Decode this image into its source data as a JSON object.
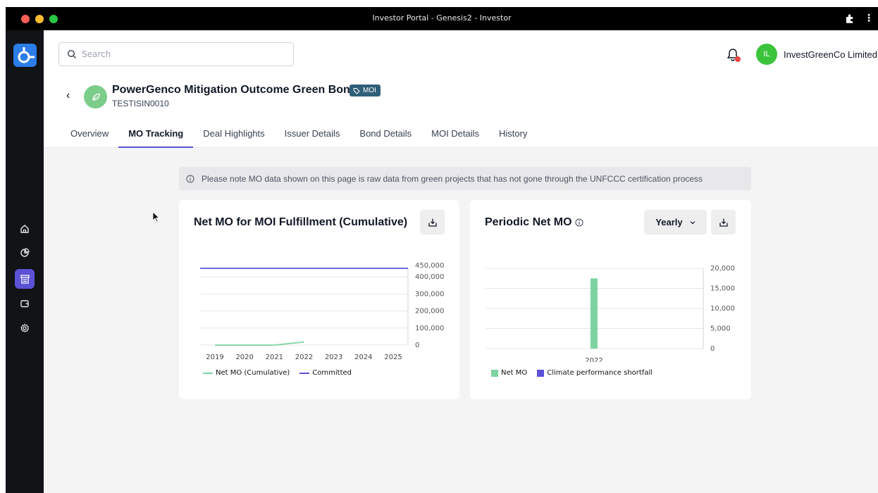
{
  "window": {
    "title": "Investor Portal - Genesis2 - Investor"
  },
  "search": {
    "placeholder": "Search"
  },
  "user": {
    "initials": "IL",
    "name": "InvestGreenCo Limited"
  },
  "bond": {
    "name": "PowerGenco Mitigation Outcome Green Bond",
    "tag": "MOI",
    "code": "TESTISIN0010"
  },
  "tabs": [
    {
      "label": "Overview"
    },
    {
      "label": "MO Tracking",
      "active": true
    },
    {
      "label": "Deal Highlights"
    },
    {
      "label": "Issuer Details"
    },
    {
      "label": "Bond Details"
    },
    {
      "label": "MOI Details"
    },
    {
      "label": "History"
    }
  ],
  "notice": {
    "text": "Please note MO data shown on this page is raw data from green projects that has not gone through the UNFCCC certification process"
  },
  "cards": {
    "cumulative": {
      "title": "Net MO for MOI Fulfillment (Cumulative)"
    },
    "periodic": {
      "title": "Periodic Net MO",
      "period": "Yearly"
    }
  },
  "chart_data": [
    {
      "type": "line",
      "x": [
        "2019",
        "2020",
        "2021",
        "2022",
        "2023",
        "2024",
        "2025"
      ],
      "yticks": [
        "0",
        "100,000",
        "200,000",
        "300,000",
        "400,000",
        "450,000"
      ],
      "ylim": [
        0,
        450000
      ],
      "series": [
        {
          "name": "Net MO (Cumulative)",
          "color": "#7dd3a0",
          "values": [
            0,
            0,
            0,
            18000,
            null,
            null,
            null
          ]
        },
        {
          "name": "Committed",
          "color": "#5b52d6",
          "values": [
            450000,
            450000,
            450000,
            450000,
            450000,
            450000,
            450000
          ]
        }
      ]
    },
    {
      "type": "bar",
      "categories": [
        "2022"
      ],
      "yticks": [
        "0",
        "5,000",
        "10,000",
        "15,000",
        "20,000"
      ],
      "ylim": [
        0,
        20000
      ],
      "series": [
        {
          "name": "Net MO",
          "color": "#7dd3a0",
          "values": [
            17500
          ]
        },
        {
          "name": "Climate performance shortfall",
          "color": "#5b52d6",
          "values": [
            0
          ]
        }
      ]
    }
  ]
}
